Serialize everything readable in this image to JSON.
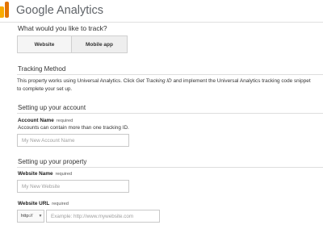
{
  "header": {
    "brand_google": "Google",
    "brand_product": "Analytics"
  },
  "track": {
    "question": "What would you like to track?",
    "options": [
      {
        "label": "Website",
        "selected": true
      },
      {
        "label": "Mobile app",
        "selected": false
      }
    ]
  },
  "tracking_method": {
    "heading": "Tracking Method",
    "line1_before": "This property works using Universal Analytics. Click ",
    "line1_link": "Get Tracking ID",
    "line1_after": " and implement the Universal Analytics tracking code snippet",
    "line2": "to complete your set up."
  },
  "account": {
    "heading": "Setting up your account",
    "name_label": "Account Name",
    "name_required": "required",
    "name_hint": "Accounts can contain more than one tracking ID.",
    "name_placeholder": "My New Account Name"
  },
  "property": {
    "heading": "Setting up your property",
    "website_name_label": "Website Name",
    "website_name_required": "required",
    "website_name_placeholder": "My New Website",
    "url_label": "Website URL",
    "url_required": "required",
    "protocol_value": "http://",
    "url_placeholder": "Example: http://www.mywebsite.com"
  },
  "colors": {
    "logo_light": "#F9AB00",
    "logo_dark": "#E37400"
  },
  "icons": {
    "logo": "analytics-bar-logo-icon",
    "dropdown": "chevron-down-icon"
  }
}
